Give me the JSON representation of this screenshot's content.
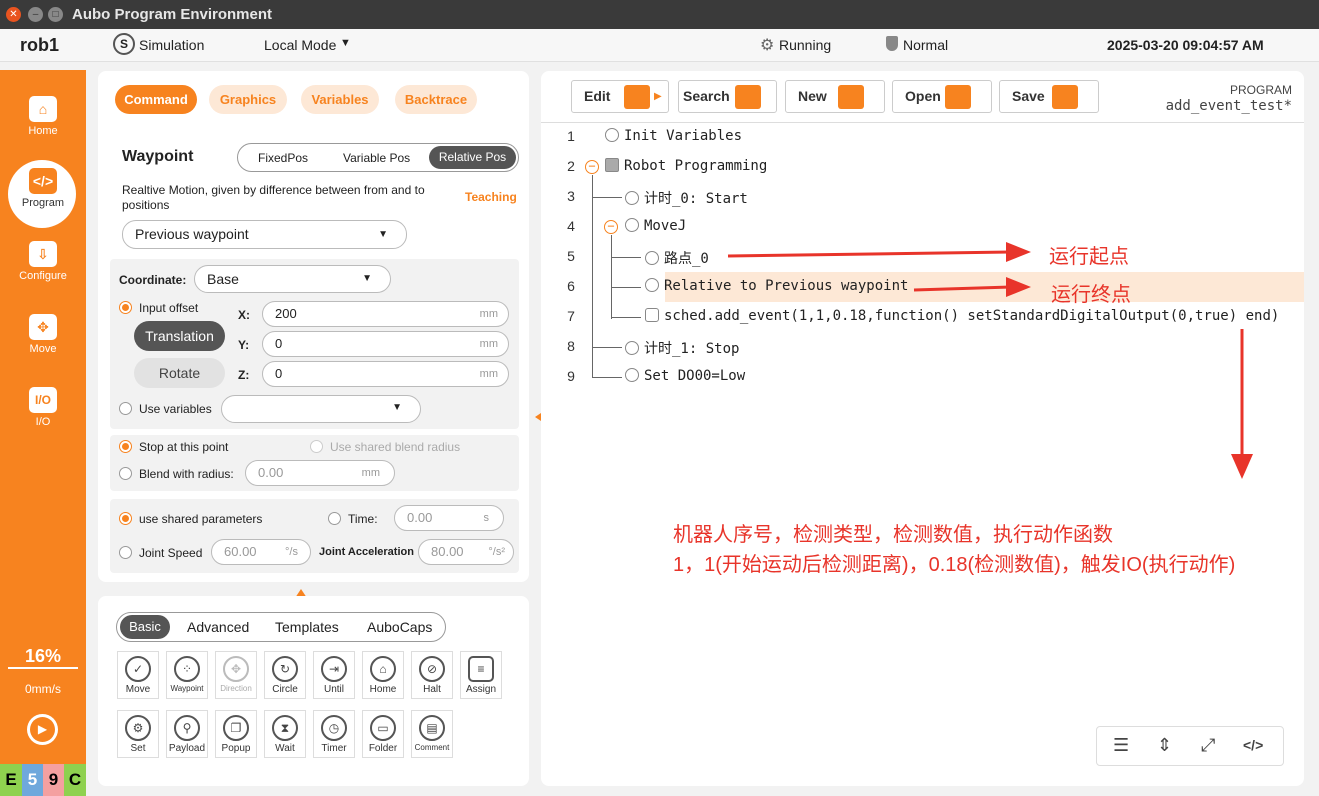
{
  "window": {
    "title": "Aubo Program Environment"
  },
  "topbar": {
    "robot": "rob1",
    "mode_sim": "Simulation",
    "mode_local": "Local Mode",
    "status": "Running",
    "safety": "Normal",
    "datetime": "2025-03-20 09:04:57 AM"
  },
  "sidebar": {
    "items": [
      {
        "label": "Home"
      },
      {
        "label": "Program"
      },
      {
        "label": "Configure"
      },
      {
        "label": "Move"
      },
      {
        "label": "I/O",
        "icon_text": "I/O"
      }
    ],
    "speed_pct": "16%",
    "speed_mms": "0mm/s",
    "status_letters": [
      "E",
      "5",
      "9",
      "C"
    ]
  },
  "command_panel": {
    "tabs": [
      "Command",
      "Graphics",
      "Variables",
      "Backtrace"
    ],
    "title": "Waypoint",
    "pos_tabs": [
      "FixedPos",
      "Variable Pos",
      "Relative Pos"
    ],
    "description": "Realtive Motion, given by difference between from and to positions",
    "teaching": "Teaching",
    "waypoint_select": "Previous waypoint",
    "coordinate_label": "Coordinate:",
    "coordinate_value": "Base",
    "input_offset": "Input offset",
    "translation": "Translation",
    "rotate": "Rotate",
    "x_label": "X:",
    "x_value": "200",
    "y_label": "Y:",
    "y_value": "0",
    "z_label": "Z:",
    "z_value": "0",
    "unit_mm": "mm",
    "use_variables": "Use variables",
    "stop_at_point": "Stop at this point",
    "use_shared_blend": "Use shared blend radius",
    "blend_with_radius": "Blend with radius:",
    "blend_value": "0.00",
    "use_shared_params": "use shared parameters",
    "time_label": "Time:",
    "time_value": "0.00",
    "time_unit": "s",
    "joint_speed": "Joint Speed",
    "joint_speed_value": "60.00",
    "joint_speed_unit": "°/s",
    "joint_accel": "Joint Acceleration",
    "joint_accel_value": "80.00",
    "joint_accel_unit": "°/s²"
  },
  "toolbox": {
    "tabs": [
      "Basic",
      "Advanced",
      "Templates",
      "AuboCaps"
    ],
    "row1": [
      "Move",
      "Waypoint",
      "Direction",
      "Circle",
      "Until",
      "Home",
      "Halt",
      "Assign"
    ],
    "row2": [
      "Set",
      "Payload",
      "Popup",
      "Wait",
      "Timer",
      "Folder",
      "Comment"
    ]
  },
  "editor": {
    "buttons": [
      "Edit",
      "Search",
      "New",
      "Open",
      "Save"
    ],
    "program_label": "PROGRAM",
    "program_name": "add_event_test*",
    "lines": [
      {
        "n": "1",
        "text": "Init Variables"
      },
      {
        "n": "2",
        "text": "Robot Programming"
      },
      {
        "n": "3",
        "text": "计时_0: Start"
      },
      {
        "n": "4",
        "text": "MoveJ"
      },
      {
        "n": "5",
        "text": "路点_0"
      },
      {
        "n": "6",
        "text": "Relative to Previous waypoint"
      },
      {
        "n": "7",
        "text": "sched.add_event(1,1,0.18,function() setStandardDigitalOutput(0,true) end)"
      },
      {
        "n": "8",
        "text": "计时_1: Stop"
      },
      {
        "n": "9",
        "text": "Set DO00=Low"
      }
    ],
    "annotation_start": "运行起点",
    "annotation_end": "运行终点",
    "note_line1": "机器人序号，检测类型，检测数值，执行动作函数",
    "note_line2": "1，1(开始运动后检测距离)，0.18(检测数值)，触发IO(执行动作)"
  }
}
